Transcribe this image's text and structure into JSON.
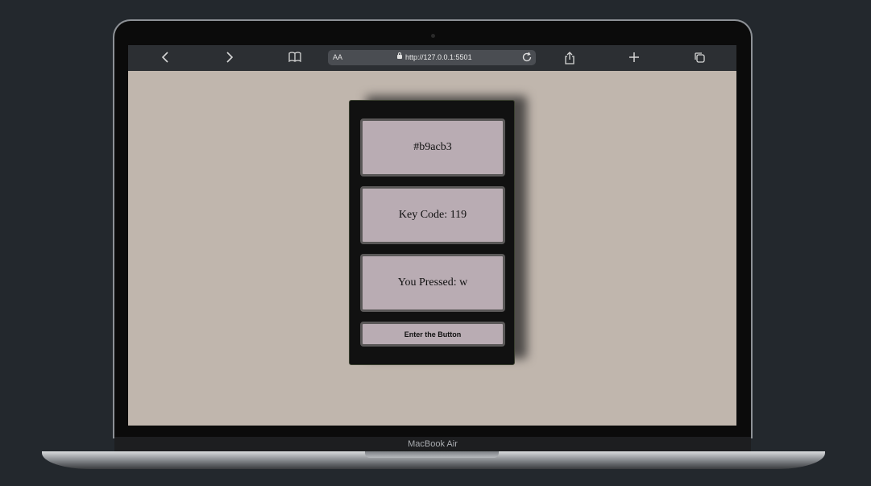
{
  "device": {
    "brand_label": "MacBook Air"
  },
  "browser": {
    "text_size_label": "AA",
    "url": "http://127.0.0.1:5501",
    "icons": [
      "back-icon",
      "forward-icon",
      "bookmarks-icon",
      "lock-icon",
      "reload-icon",
      "share-icon",
      "new-tab-icon",
      "tabs-icon"
    ]
  },
  "page": {
    "background_color": "#c0b6ad",
    "color_display": "#b9acb3",
    "key_code_display": "Key Code: 119",
    "pressed_display": "You Pressed: w",
    "button_label": "Enter the Button"
  }
}
